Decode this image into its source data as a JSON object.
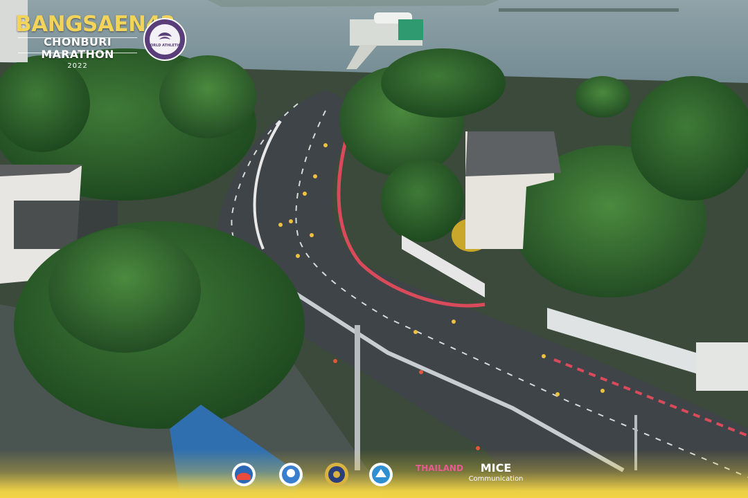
{
  "branding": {
    "title": "BANGSAEN42",
    "subtitle": "CHONBURI MARATHON",
    "year": "2022",
    "badge_text": "WORLD ATHLETICS",
    "badge_ring": "ELITE LABEL ROAD RACE 2022"
  },
  "sponsors": {
    "mice_label": "MICE",
    "mice_sub": "Communication",
    "thai_label": "THAILAND"
  },
  "colors": {
    "title_gold": "#f2d45c",
    "badge_purple": "#5a3e7a",
    "footer_yellow": "#f3d445"
  }
}
